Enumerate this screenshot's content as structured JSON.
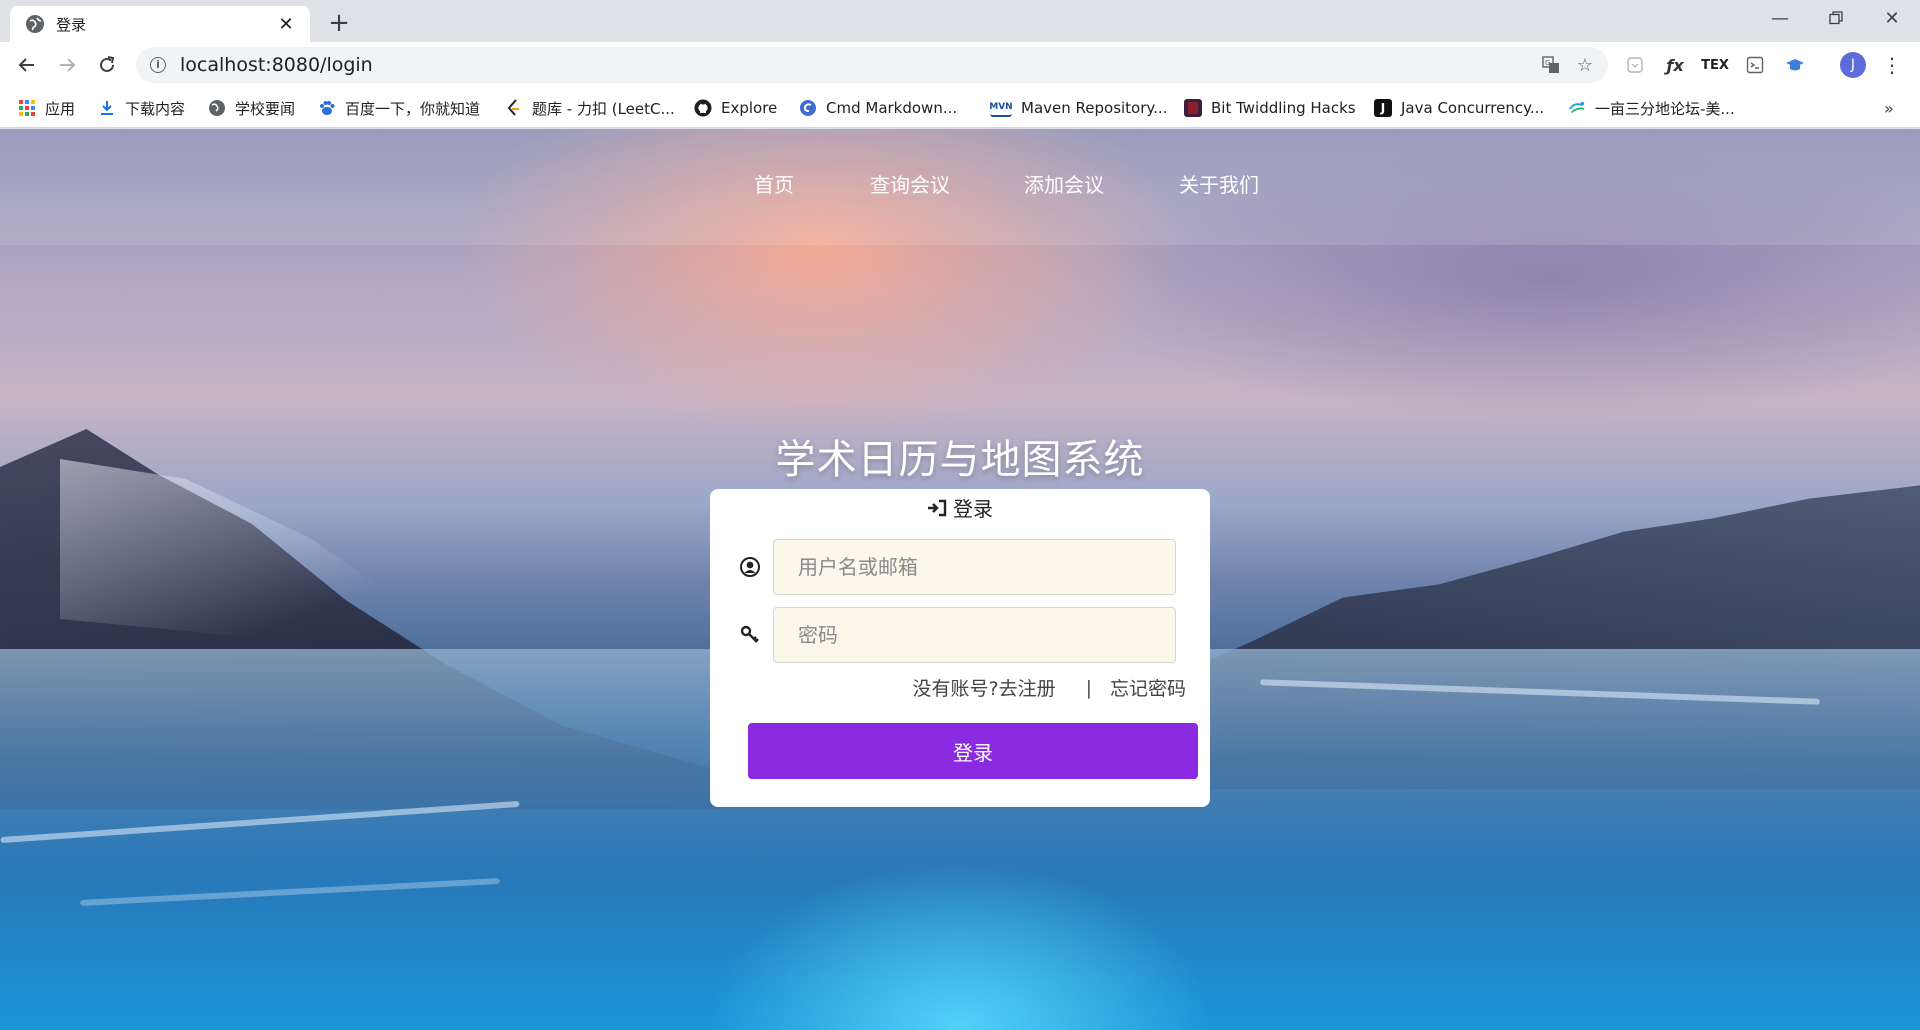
{
  "browser": {
    "tab_title": "登录",
    "new_tab_label": "+",
    "url": "localhost:8080/login",
    "profile_initial": "J",
    "bookmarks": [
      {
        "label": "应用",
        "icon": "apps-grid-icon"
      },
      {
        "label": "下载内容",
        "icon": "download-icon"
      },
      {
        "label": "学校要闻",
        "icon": "globe-icon"
      },
      {
        "label": "百度一下，你就知道",
        "icon": "baidu-paw-icon"
      },
      {
        "label": "题库 - 力扣 (LeetC...",
        "icon": "leetcode-icon"
      },
      {
        "label": "Explore",
        "icon": "github-icon"
      },
      {
        "label": "Cmd Markdown...",
        "icon": "cmd-markdown-icon"
      },
      {
        "label": "Maven Repository...",
        "icon": "maven-icon"
      },
      {
        "label": "Bit Twiddling Hacks",
        "icon": "bit-twiddling-icon"
      },
      {
        "label": "Java Concurrency...",
        "icon": "java-j-icon"
      },
      {
        "label": "一亩三分地论坛-美...",
        "icon": "forum-icon"
      }
    ],
    "bookmarks_overflow": "»"
  },
  "page": {
    "nav": [
      "首页",
      "查询会议",
      "添加会议",
      "关于我们"
    ],
    "site_title": "学术日历与地图系统",
    "login": {
      "header": "登录",
      "username_placeholder": "用户名或邮箱",
      "password_placeholder": "密码",
      "register_link": "没有账号?去注册",
      "separator": "|",
      "forgot_link": "忘记密码",
      "submit_label": "登录"
    }
  },
  "colors": {
    "accent": "#8a2be2",
    "input_bg": "#fbf7ea"
  }
}
